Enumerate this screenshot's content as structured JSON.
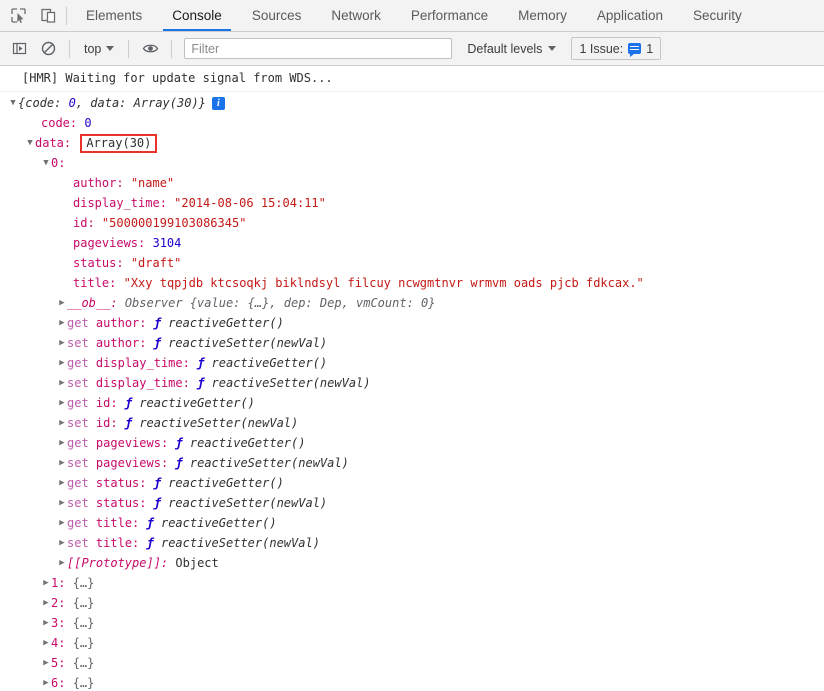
{
  "tabstrip": {
    "icons": [
      {
        "name": "inspect-element-icon",
        "title": "Inspect element"
      },
      {
        "name": "device-toolbar-icon",
        "title": "Toggle device toolbar"
      }
    ],
    "tabs": [
      {
        "label": "Elements",
        "active": false
      },
      {
        "label": "Console",
        "active": true
      },
      {
        "label": "Sources",
        "active": false
      },
      {
        "label": "Network",
        "active": false
      },
      {
        "label": "Performance",
        "active": false
      },
      {
        "label": "Memory",
        "active": false
      },
      {
        "label": "Application",
        "active": false
      },
      {
        "label": "Security",
        "active": false
      }
    ],
    "active_underline_color": "#1a73e8"
  },
  "toolbar": {
    "sidebar_toggle": "show-console-sidebar-icon",
    "clear_console": "clear-console-icon",
    "context_label": "top",
    "eye_icon": "live-expression-eye-icon",
    "filter_placeholder": "Filter",
    "filter_value": "",
    "levels_label": "Default levels",
    "issues_label": "1 Issue:",
    "issues_count": "1",
    "issues_accent": "#1a73e8"
  },
  "console": {
    "hmr_message": "[HMR] Waiting for update signal from WDS...",
    "root_preview": {
      "open": "{",
      "code_key": "code:",
      "code_val": "0",
      "sep": ", ",
      "data_key": "data:",
      "data_val": "Array(30)",
      "close": "}",
      "info_icon": "info-icon"
    },
    "code_line": {
      "key": "code:",
      "value": "0"
    },
    "data_line": {
      "key": "data:",
      "value": "Array(30)",
      "highlighted": true,
      "highlight_color": "#e8332a"
    },
    "index_line": {
      "key": "0:"
    },
    "props": [
      {
        "key": "author:",
        "value": "\"name\"",
        "type": "string"
      },
      {
        "key": "display_time:",
        "value": "\"2014-08-06 15:04:11\"",
        "type": "string"
      },
      {
        "key": "id:",
        "value": "\"500000199103086345\"",
        "type": "string"
      },
      {
        "key": "pageviews:",
        "value": "3104",
        "type": "number"
      },
      {
        "key": "status:",
        "value": "\"draft\"",
        "type": "string"
      },
      {
        "key": "title:",
        "value": "\"Xxy tqpjdb ktcsoqkj biklndsyl filcuy ncwgmtnvr wrmvm oads pjcb fdkcax.\"",
        "type": "string"
      }
    ],
    "observer_line": {
      "key": "__ob__:",
      "value": "Observer {value: {…}, dep: Dep, vmCount: 0}"
    },
    "accessors": [
      {
        "kind": "get",
        "key": "author:",
        "fn": "reactiveGetter()"
      },
      {
        "kind": "set",
        "key": "author:",
        "fn": "reactiveSetter(newVal)"
      },
      {
        "kind": "get",
        "key": "display_time:",
        "fn": "reactiveGetter()"
      },
      {
        "kind": "set",
        "key": "display_time:",
        "fn": "reactiveSetter(newVal)"
      },
      {
        "kind": "get",
        "key": "id:",
        "fn": "reactiveGetter()"
      },
      {
        "kind": "set",
        "key": "id:",
        "fn": "reactiveSetter(newVal)"
      },
      {
        "kind": "get",
        "key": "pageviews:",
        "fn": "reactiveGetter()"
      },
      {
        "kind": "set",
        "key": "pageviews:",
        "fn": "reactiveSetter(newVal)"
      },
      {
        "kind": "get",
        "key": "status:",
        "fn": "reactiveGetter()"
      },
      {
        "kind": "set",
        "key": "status:",
        "fn": "reactiveSetter(newVal)"
      },
      {
        "kind": "get",
        "key": "title:",
        "fn": "reactiveGetter()"
      },
      {
        "kind": "set",
        "key": "title:",
        "fn": "reactiveSetter(newVal)"
      }
    ],
    "fn_glyph": "ƒ",
    "prototype_line": {
      "key": "[[Prototype]]:",
      "value": "Object"
    },
    "array_items": [
      {
        "key": "1:",
        "value": "{…}"
      },
      {
        "key": "2:",
        "value": "{…}"
      },
      {
        "key": "3:",
        "value": "{…}"
      },
      {
        "key": "4:",
        "value": "{…}"
      },
      {
        "key": "5:",
        "value": "{…}"
      },
      {
        "key": "6:",
        "value": "{…}"
      }
    ],
    "arrow_collapsed": "▶",
    "arrow_expanded": "▼"
  }
}
